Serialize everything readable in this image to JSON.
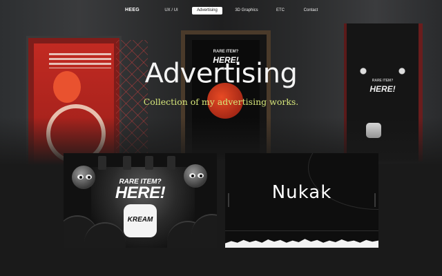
{
  "nav": {
    "brand": "HEEG",
    "items": [
      {
        "label": "UX / UI",
        "active": false
      },
      {
        "label": "Advertising",
        "active": true
      },
      {
        "label": "3D Graphics",
        "active": false
      },
      {
        "label": "ETC",
        "active": false
      },
      {
        "label": "Contact",
        "active": false
      }
    ]
  },
  "hero": {
    "title": "Advertising",
    "subtitle": "Collection of my advertising works.",
    "photo_posters": {
      "center_top": "RARE ITEM?",
      "center_big": "HERE!",
      "right_top": "RARE ITEM?",
      "right_big": "HERE!"
    }
  },
  "works": [
    {
      "id": "kream",
      "line1": "RARE ITEM?",
      "line2": "HERE!",
      "badge": "KREAM"
    },
    {
      "id": "nukak",
      "logo": "Nukak"
    }
  ],
  "colors": {
    "background": "#1a1a1a",
    "subtitle": "#d6e67a",
    "nav_active_bg": "#ffffff"
  }
}
